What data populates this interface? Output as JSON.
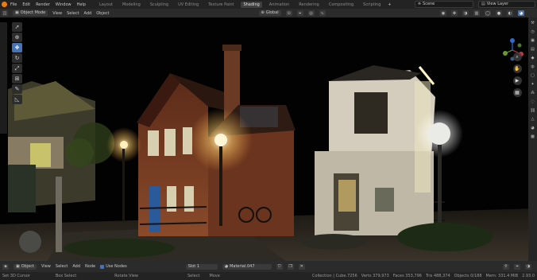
{
  "topbar": {
    "menu": [
      "File",
      "Edit",
      "Render",
      "Window",
      "Help"
    ],
    "tabs": [
      "Layout",
      "Modeling",
      "Sculpting",
      "UV Editing",
      "Texture Paint",
      "Shading",
      "Animation",
      "Rendering",
      "Compositing",
      "Scripting"
    ],
    "active_tab": "Shading",
    "add_tab": "+",
    "scene_label": "Scene",
    "view_layer_label": "View Layer"
  },
  "viewport_header": {
    "mode": "Object Mode",
    "menu": [
      "View",
      "Select",
      "Add",
      "Object"
    ],
    "transform": "Global"
  },
  "node_header": {
    "editor_type": "Object",
    "menu": [
      "View",
      "Select",
      "Add",
      "Node"
    ],
    "use_nodes_label": "Use Nodes",
    "slot": "Slot 1",
    "material": "Material.047"
  },
  "statusbar": {
    "left": [
      "Set 3D Cursor",
      "Box Select",
      "Rotate View",
      "Select",
      "Move"
    ],
    "right": [
      "Collection | Cube.7256",
      "Verts 379,973",
      "Faces 353,796",
      "Tris 488,374",
      "Objects 0/188",
      "Mem: 331.4 MiB",
      "2.93.0"
    ]
  },
  "icons": {
    "logo": "blender-logo-icon",
    "tools": [
      "cursor-select-icon",
      "3d-cursor-icon",
      "move-icon",
      "rotate-icon",
      "scale-icon",
      "transform-icon",
      "annotate-icon",
      "measure-icon"
    ],
    "nav": [
      "zoom-icon",
      "hand-pan-icon",
      "camera-view-icon",
      "grid-toggle-icon"
    ]
  },
  "colors": {
    "accent": "#4772b3",
    "logo": "#e87d0d",
    "lamp": "#ffe9b0",
    "brick": "#7a3a22"
  }
}
